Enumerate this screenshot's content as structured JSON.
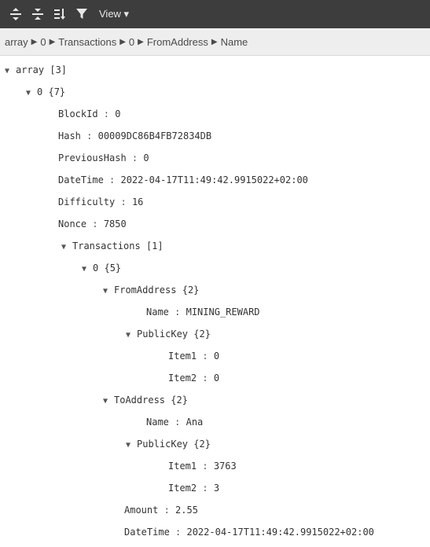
{
  "toolbar": {
    "view_label": "View ▾"
  },
  "breadcrumb": [
    "array",
    "0",
    "Transactions",
    "0",
    "FromAddress",
    "Name"
  ],
  "tree": {
    "root": {
      "key": "array",
      "count": "[3]"
    },
    "item0": {
      "key": "0",
      "count": "{7}"
    },
    "block_id": {
      "key": "BlockId",
      "value": "0"
    },
    "hash": {
      "key": "Hash",
      "value": "00009DC86B4FB72834DB"
    },
    "previous_hash": {
      "key": "PreviousHash",
      "value": "0"
    },
    "datetime": {
      "key": "DateTime",
      "value": "2022-04-17T11:49:42.9915022+02:00"
    },
    "difficulty": {
      "key": "Difficulty",
      "value": "16"
    },
    "nonce": {
      "key": "Nonce",
      "value": "7850"
    },
    "transactions": {
      "key": "Transactions",
      "count": "[1]"
    },
    "tx0": {
      "key": "0",
      "count": "{5}"
    },
    "from_address": {
      "key": "FromAddress",
      "count": "{2}"
    },
    "from_name": {
      "key": "Name",
      "value": "MINING_REWARD"
    },
    "from_public_key": {
      "key": "PublicKey",
      "count": "{2}"
    },
    "from_item1": {
      "key": "Item1",
      "value": "0"
    },
    "from_item2": {
      "key": "Item2",
      "value": "0"
    },
    "to_address": {
      "key": "ToAddress",
      "count": "{2}"
    },
    "to_name": {
      "key": "Name",
      "value": "Ana"
    },
    "to_public_key": {
      "key": "PublicKey",
      "count": "{2}"
    },
    "to_item1": {
      "key": "Item1",
      "value": "3763"
    },
    "to_item2": {
      "key": "Item2",
      "value": "3"
    },
    "amount": {
      "key": "Amount",
      "value": "2.55"
    },
    "tx_datetime": {
      "key": "DateTime",
      "value": "2022-04-17T11:49:42.9915022+02:00"
    }
  },
  "colors": {
    "toolbar_bg": "#3d3d3d",
    "breadcrumb_bg": "#eeeeee",
    "text": "#333333"
  }
}
